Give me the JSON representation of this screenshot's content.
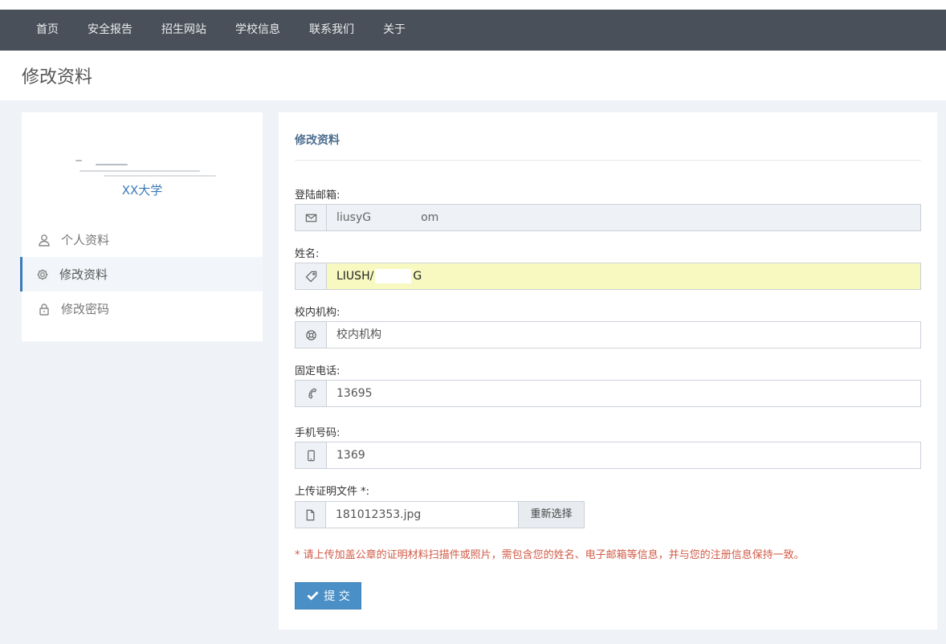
{
  "nav": {
    "items": [
      "首页",
      "安全报告",
      "招生网站",
      "学校信息",
      "联系我们",
      "关于"
    ]
  },
  "page_title": "修改资料",
  "sidebar": {
    "school": "XX大学",
    "menu": [
      {
        "label": "个人资料",
        "icon": "user-icon"
      },
      {
        "label": "修改资料",
        "icon": "gear-icon"
      },
      {
        "label": "修改密码",
        "icon": "lock-icon"
      }
    ]
  },
  "form": {
    "title": "修改资料",
    "email": {
      "label": "登陆邮箱:",
      "value_start": "liusyG",
      "value_end": "om",
      "icon": "envelope-icon"
    },
    "name": {
      "label": "姓名:",
      "value_start": "LIUSH/",
      "value_end": "G",
      "icon": "tag-icon"
    },
    "org": {
      "label": "校内机构:",
      "value": "校内机构",
      "icon": "lifebuoy-icon"
    },
    "phone": {
      "label": "固定电话:",
      "value": "13695",
      "icon": "phone-icon"
    },
    "mobile": {
      "label": "手机号码:",
      "value": "1369",
      "icon": "mobile-icon"
    },
    "upload": {
      "label": "上传证明文件 *:",
      "file_name": "181012353.jpg",
      "reselect_label": "重新选择",
      "icon": "file-icon"
    },
    "note": "* 请上传加盖公章的证明材料扫描件或照片，需包含您的姓名、电子邮箱等信息，并与您的注册信息保持一致。",
    "submit_label": "提 交"
  },
  "colors": {
    "navbar": "#4a5059",
    "accent": "#3c7ab8",
    "submit": "#4a8fc6",
    "note": "#d15b47",
    "highlight": "#f7f9c0"
  }
}
